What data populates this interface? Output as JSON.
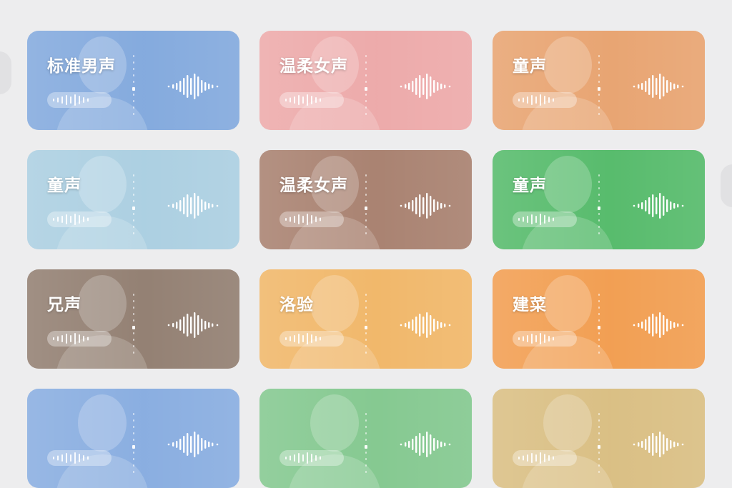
{
  "voices": [
    {
      "title": "标准男声",
      "color": "#7ea6dc"
    },
    {
      "title": "温柔女声",
      "color": "#eca6a6"
    },
    {
      "title": "童声",
      "color": "#e7a06b"
    },
    {
      "title": "童声",
      "color": "#a8cde0"
    },
    {
      "title": "温柔女声",
      "color": "#a57c6a"
    },
    {
      "title": "童声",
      "color": "#4fb865"
    },
    {
      "title": "兄声",
      "color": "#8e7a6c"
    },
    {
      "title": "洛验",
      "color": "#f0b463"
    },
    {
      "title": "建菜",
      "color": "#f19a4a"
    },
    {
      "title": "",
      "color": "#84aadf"
    },
    {
      "title": "",
      "color": "#7fc68b"
    },
    {
      "title": "",
      "color": "#d8bc7e"
    }
  ],
  "icons": {
    "sound_wave": "sound-wave-icon",
    "volume": "volume-icon",
    "scroll_left": "chevron-left-icon",
    "scroll_right": "chevron-right-icon"
  }
}
